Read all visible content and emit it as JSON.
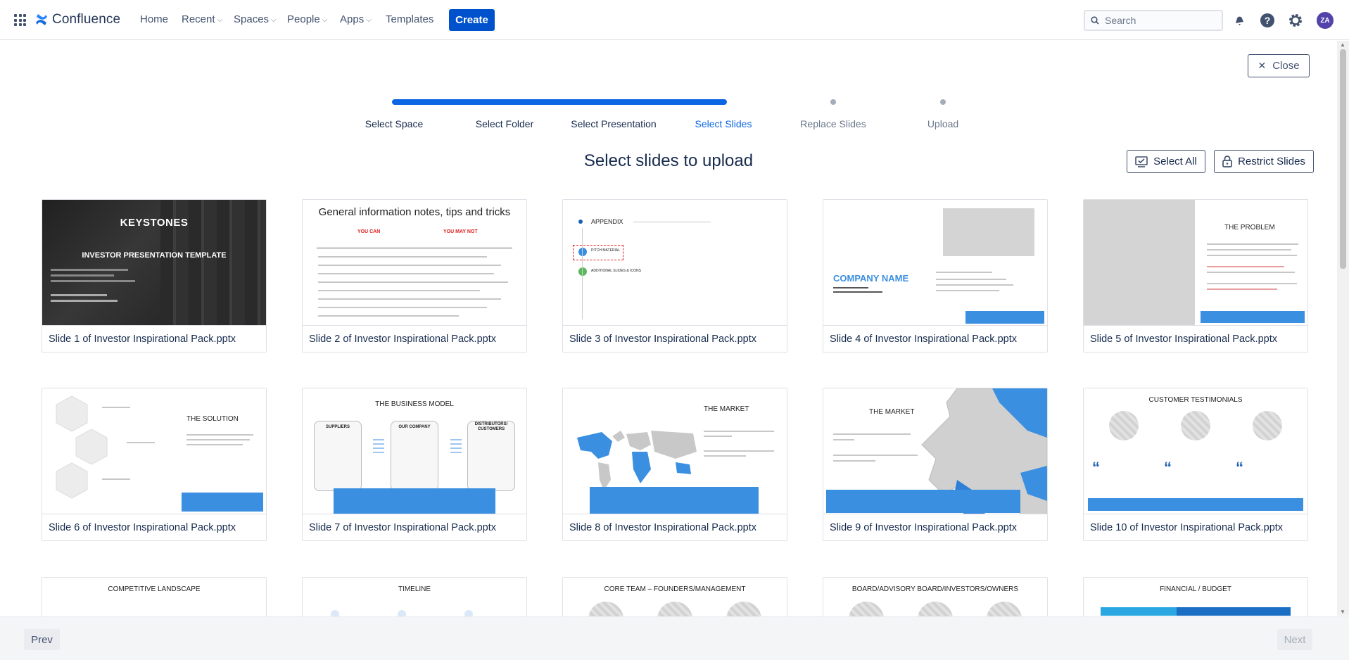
{
  "header": {
    "app_name": "Confluence",
    "nav": [
      {
        "label": "Home",
        "has_dropdown": false
      },
      {
        "label": "Recent",
        "has_dropdown": true
      },
      {
        "label": "Spaces",
        "has_dropdown": true
      },
      {
        "label": "People",
        "has_dropdown": true
      },
      {
        "label": "Apps",
        "has_dropdown": true
      },
      {
        "label": "Templates",
        "has_dropdown": false
      }
    ],
    "create_label": "Create",
    "search_placeholder": "Search",
    "avatar_initials": "ZA",
    "icons": [
      "app-switcher-icon",
      "confluence-logo-icon",
      "search-icon",
      "notifications-icon",
      "help-icon",
      "settings-icon"
    ]
  },
  "close_label": "Close",
  "stepper": {
    "steps": [
      "Select Space",
      "Select Folder",
      "Select Presentation",
      "Select Slides",
      "Replace Slides",
      "Upload"
    ],
    "current_step": "Select Slides"
  },
  "heading": "Select slides to upload",
  "actions": {
    "select_all": "Select All",
    "restrict_slides": "Restrict Slides"
  },
  "slides": [
    {
      "caption": "Slide 1 of Investor Inspirational Pack.pptx",
      "title": "KEYSTONES",
      "subtitle": "INVESTOR PRESENTATION TEMPLATE"
    },
    {
      "caption": "Slide 2 of Investor Inspirational Pack.pptx",
      "title": "General information notes, tips and tricks",
      "col_left": "YOU CAN",
      "col_right": "YOU MAY NOT"
    },
    {
      "caption": "Slide 3 of Investor Inspirational Pack.pptx",
      "title": "APPENDIX",
      "item_1": "PITCH MATERIAL",
      "item_2": "ADDITIONAL SLIDES & ICONS"
    },
    {
      "caption": "Slide 4 of Investor Inspirational Pack.pptx",
      "title": "COMPANY NAME"
    },
    {
      "caption": "Slide 5 of Investor Inspirational Pack.pptx",
      "title": "THE PROBLEM"
    },
    {
      "caption": "Slide 6 of Investor Inspirational Pack.pptx",
      "title": "THE SOLUTION"
    },
    {
      "caption": "Slide 7 of Investor Inspirational Pack.pptx",
      "title": "THE BUSINESS MODEL",
      "columns": [
        "SUPPLIERS",
        "OUR COMPANY",
        "DISTRIBUTORS/ CUSTOMERS"
      ]
    },
    {
      "caption": "Slide 8 of Investor Inspirational Pack.pptx",
      "title": "THE MARKET"
    },
    {
      "caption": "Slide 9 of Investor Inspirational Pack.pptx",
      "title": "THE MARKET"
    },
    {
      "caption": "Slide 10 of Investor Inspirational Pack.pptx",
      "title": "CUSTOMER TESTIMONIALS"
    },
    {
      "caption": "",
      "title": "COMPETITIVE LANDSCAPE"
    },
    {
      "caption": "",
      "title": "TIMELINE"
    },
    {
      "caption": "",
      "title": "CORE TEAM – FOUNDERS/MANAGEMENT"
    },
    {
      "caption": "",
      "title": "BOARD/ADVISORY BOARD/INVESTORS/OWNERS"
    },
    {
      "caption": "",
      "title": "FINANCIAL / BUDGET"
    }
  ],
  "footer": {
    "prev_label": "Prev",
    "next_label": "Next"
  },
  "colors": {
    "primary": "#0052cc",
    "progress": "#0c66e4",
    "text": "#172b4d",
    "slide_accent": "#3b8fe0"
  }
}
